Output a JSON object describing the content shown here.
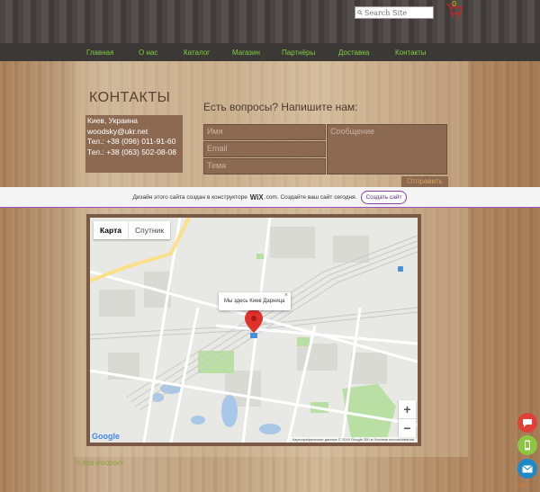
{
  "header": {
    "search_placeholder": "Search Site",
    "cart_count": "0"
  },
  "nav": {
    "items": [
      {
        "label": "Главная"
      },
      {
        "label": "О нас"
      },
      {
        "label": "Каталог"
      },
      {
        "label": "Магазин"
      },
      {
        "label": "Партнёры"
      },
      {
        "label": "Доставка"
      },
      {
        "label": "Контакты"
      }
    ]
  },
  "contacts": {
    "title": "КОНТАКТЫ",
    "address": "Киев, Украина",
    "email": "woodsky@ukr.net",
    "phone1": "Тел.: +38 (096) 011-91-60",
    "phone2": "Тел.: +38 (063) 502-08-08"
  },
  "form": {
    "heading": "Есть вопросы? Напишите нам:",
    "name_placeholder": "Имя",
    "email_placeholder": "Email",
    "subject_placeholder": "Тема",
    "message_placeholder": "Сообщение",
    "send_label": "Отправить"
  },
  "wix_banner": {
    "text_before": "Дизайн этого сайта создан в конструкторе",
    "brand": "WiX",
    "brand_suffix": ".com.",
    "text_after": "Создайте ваш сайт сегодня.",
    "button_label": "Создать сайт"
  },
  "map": {
    "tab_map": "Карта",
    "tab_satellite": "Спутник",
    "bubble_text": "Мы здесь Киев Дарница",
    "close_symbol": "×",
    "zoom_in": "+",
    "zoom_out": "−",
    "logo": "Google",
    "footer_text": "Картографические данные © 2019 Google   200 м   Условия использования",
    "colors": {
      "water": "#a9c8e8",
      "park": "#b9dfa4",
      "road_major": "#fbe08a",
      "pin": "#e0322c"
    }
  },
  "footer": {
    "copyright": "© 2016 WOODSKY"
  },
  "side_buttons": {
    "colors": [
      "#e04036",
      "#8dc63f",
      "#1f88c6"
    ],
    "label": "Chat"
  }
}
